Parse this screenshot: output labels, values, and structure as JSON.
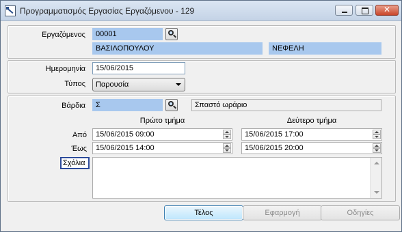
{
  "window": {
    "title": "Προγραμματισμός Εργασίας Εργαζόμενου - 129",
    "close_glyph": "✕"
  },
  "employee": {
    "label": "Εργαζόμενος",
    "code": "00001",
    "surname": "ΒΑΣΙΛΟΠΟΥΛΟΥ",
    "name": "ΝΕΦΕΛΗ"
  },
  "date": {
    "label": "Ημερομηνία",
    "value": "15/06/2015"
  },
  "type": {
    "label": "Τύπος",
    "value": "Παρουσία"
  },
  "shift": {
    "label": "Βάρδια",
    "code": "Σ",
    "description": "Σπαστό ωράριο"
  },
  "schedule": {
    "first_part_header": "Πρώτο τμήμα",
    "second_part_header": "Δεύτερο τμήμα",
    "from_label": "Από",
    "to_label": "Έως",
    "first_from": "15/06/2015 09:00",
    "first_to": "15/06/2015 14:00",
    "second_from": "15/06/2015 17:00",
    "second_to": "15/06/2015 20:00"
  },
  "notes": {
    "label": "Σχόλια",
    "value": ""
  },
  "buttons": {
    "ok": "Τέλος",
    "apply": "Εφαρμογή",
    "help": "Οδηγίες"
  }
}
